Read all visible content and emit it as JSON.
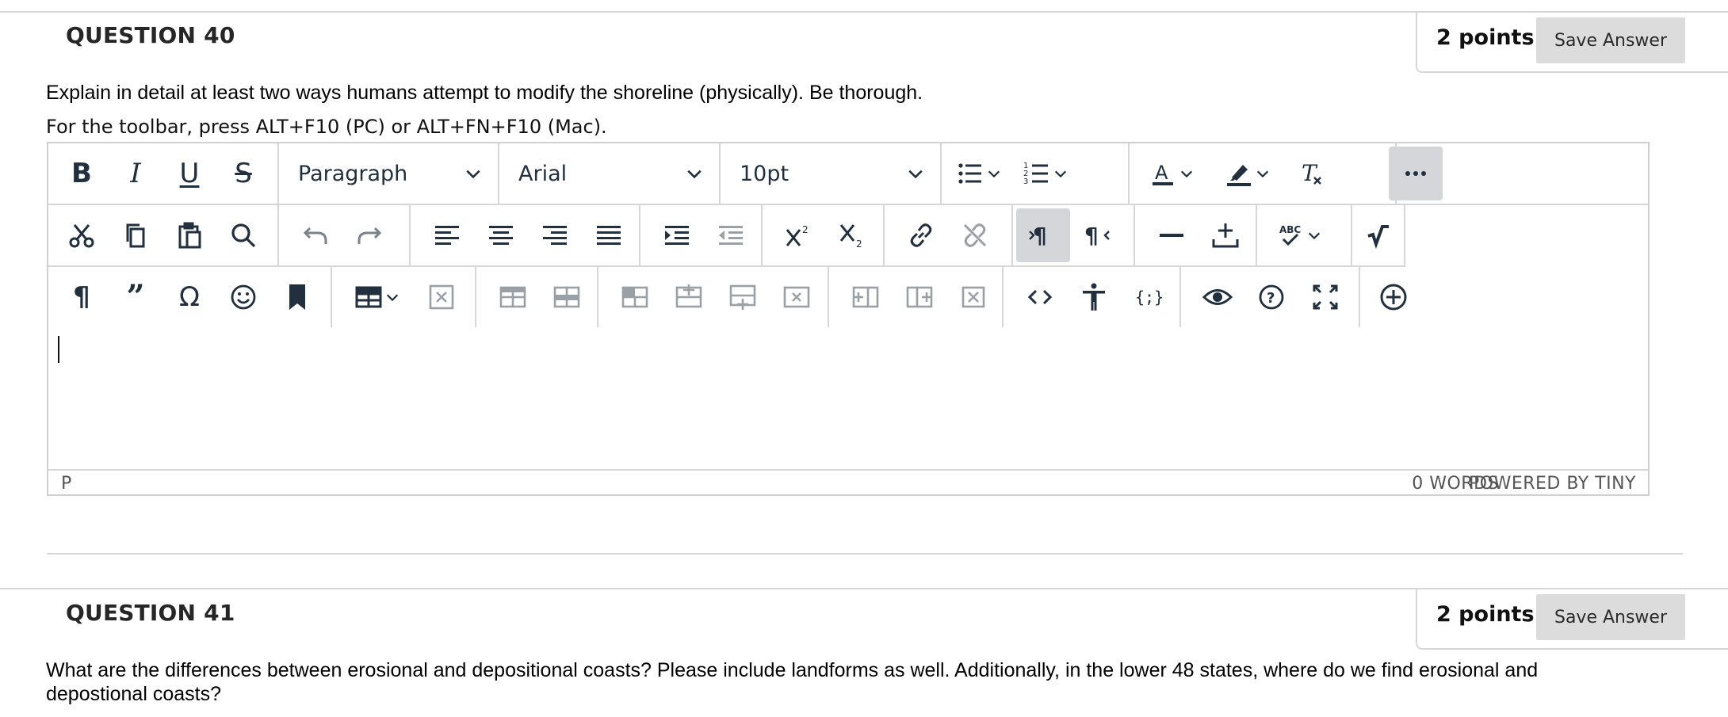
{
  "question40": {
    "title": "QUESTION 40",
    "points": "2 points",
    "save_label": "Save Answer",
    "prompt": "Explain in detail at least two ways humans attempt to modify the shoreline (physically). Be thorough.",
    "toolbar_hint": "For the toolbar, press ALT+F10 (PC) or ALT+FN+F10 (Mac)."
  },
  "editor": {
    "block_format": "Paragraph",
    "font_family": "Arial",
    "font_size": "10pt",
    "status_path": "P",
    "word_count": "0 WORDS",
    "powered_by": "POWERED BY TINY",
    "toolbar_row1": [
      "bold-icon",
      "italic-icon",
      "underline-icon",
      "strikethrough-icon",
      "bullet-list-icon",
      "numbered-list-icon",
      "text-color-icon",
      "highlight-icon",
      "clear-format-icon",
      "more-icon"
    ],
    "toolbar_row2": [
      "cut-icon",
      "copy-icon",
      "paste-icon",
      "find-replace-icon",
      "undo-icon",
      "redo-icon",
      "align-left-icon",
      "align-center-icon",
      "align-right-icon",
      "align-justify-icon",
      "indent-icon",
      "outdent-icon",
      "superscript-icon",
      "subscript-icon",
      "link-icon",
      "unlink-icon",
      "ltr-icon",
      "rtl-icon",
      "horizontal-rule-icon",
      "paste-text-icon",
      "spellcheck-icon",
      "math-icon"
    ],
    "toolbar_row3": [
      "paragraph-mark-icon",
      "blockquote-icon",
      "special-char-icon",
      "emoji-icon",
      "bookmark-icon",
      "table-icon",
      "delete-table-icon",
      "table-row-props-icon",
      "table-cell-props-icon",
      "table-merge-icon",
      "insert-row-before-icon",
      "insert-row-after-icon",
      "delete-row-icon",
      "insert-col-before-icon",
      "insert-col-after-icon",
      "delete-col-icon",
      "source-code-icon",
      "accessibility-icon",
      "template-icon",
      "preview-icon",
      "help-icon",
      "fullscreen-icon",
      "add-content-icon"
    ]
  },
  "question41": {
    "title": "QUESTION 41",
    "points": "2 points",
    "save_label": "Save Answer",
    "prompt_line1": "What are the differences between erosional and depositional coasts? Please include landforms as well. Additionally, in the lower 48 states, where do we find erosional and",
    "prompt_line2": "depostional coasts?"
  },
  "colors": {
    "icon": "#222f3e",
    "active_bg": "#d4d6d9",
    "save_bg": "#dcdcdc",
    "border": "#d6d6d6"
  }
}
